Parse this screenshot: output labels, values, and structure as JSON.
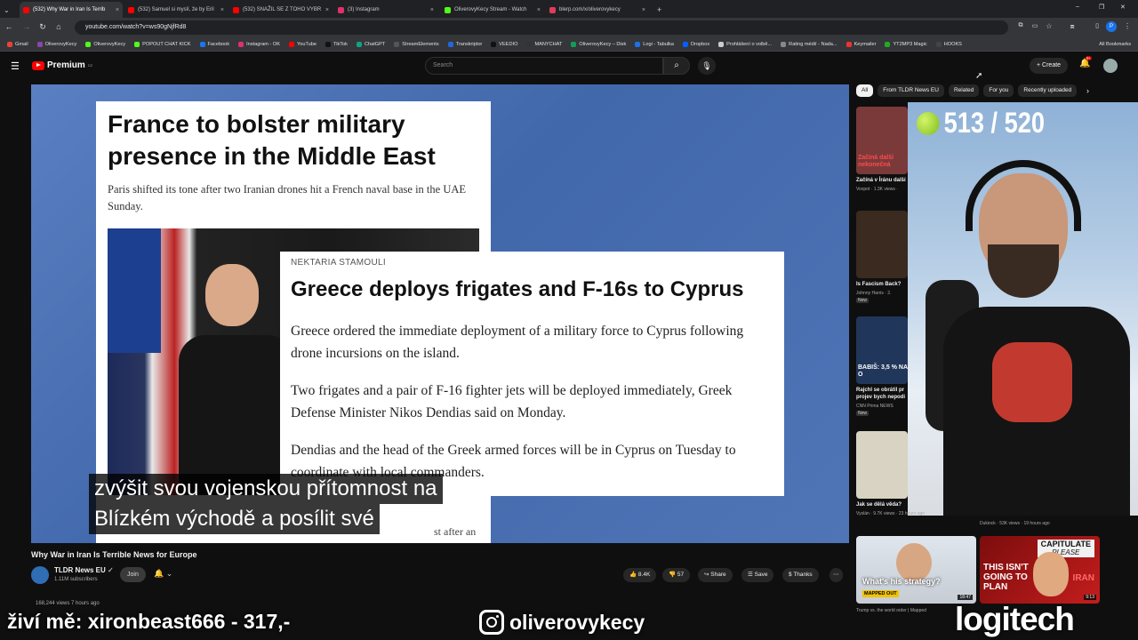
{
  "browser": {
    "tabs": [
      {
        "label": "(532) Why War in Iran Is Terrib",
        "color": "#ff0000"
      },
      {
        "label": "(532) Samuel si myslí, že by Eril",
        "color": "#ff0000"
      },
      {
        "label": "(532) SNAŽIL SE Z TOHO VYBR",
        "color": "#ff0000"
      },
      {
        "label": "(3) Instagram",
        "color": "#e1306c"
      },
      {
        "label": "OliverovyKecy Stream - Watch",
        "color": "#53fc18"
      },
      {
        "label": "blerp.com/x/oliverovykecy",
        "color": "#e23b5c"
      }
    ],
    "new_tab": "+",
    "url": "youtube.com/watch?v=ws90gNjfRd8",
    "bookmarks": [
      "Gmail",
      "OliverovyKecy",
      "OliverovyKecy",
      "POPOUT CHAT KICK",
      "Facebook",
      "Instagram - OK",
      "YouTube",
      "TikTok",
      "ChatGPT",
      "StreamElements",
      "Transkriptor",
      "VEEDIO",
      "MANYCHAT",
      "OliverovyKecy – Disk",
      "Logi - Tabulka",
      "Dropbox",
      "Prohlášení o volbě...",
      "Rating médií - Nada...",
      "Keymailer",
      "YT2MP3 Magic",
      "HOOKS"
    ],
    "all_bookmarks": "All Bookmarks"
  },
  "youtube": {
    "logo_text": "Premium",
    "logo_sup": "CZ",
    "search_placeholder": "Search",
    "create_label": "Create",
    "notif_count": "9+",
    "chips": [
      "All",
      "From TLDR News EU",
      "Related",
      "For you",
      "Recently uploaded"
    ]
  },
  "video_frame": {
    "card1_headline": "France to bolster military presence in the Middle East",
    "card1_sub": "Paris shifted its tone after two Iranian drones hit a French naval base in the UAE Sunday.",
    "card1_bottom": "st after an",
    "card2_byline": "NEKTARIA STAMOULI",
    "card2_headline": "Greece deploys frigates and F-16s to Cyprus",
    "card2_p1": "Greece ordered the immediate deployment of a military force to Cyprus following drone incursions on the island.",
    "card2_p2": "Two frigates and a pair of F-16 fighter jets will be deployed immediately, Greek Defense Minister Nikos Dendias said on Monday.",
    "card2_p3": "Dendias and the head of the Greek armed forces will be in Cyprus on Tuesday to coordinate with local commanders.",
    "subtitle_line1": "zvýšit svou vojenskou přítomnost na",
    "subtitle_line2": "Blízkém východě a posílit své"
  },
  "video_info": {
    "title": "Why War in Iran Is Terrible News for Europe",
    "channel": "TLDR News EU",
    "subscribers": "1.11M subscribers",
    "join": "Join",
    "likes": "8.4K",
    "dislikes": "57",
    "share": "Share",
    "save": "Save",
    "thanks": "Thanks",
    "views": "168,244 views  7 hours ago"
  },
  "sidebar": {
    "videos": [
      {
        "title": "Začíná v Íránu další",
        "meta": "Voxpot · 1.3K views ·",
        "thumb_text": "Začíná další nekonečná",
        "bg": "#7a3a3a"
      },
      {
        "title": "Is Fascism Back?",
        "meta": "Johnny Harris · 2.",
        "new": "New",
        "bg": "#3a2a20"
      },
      {
        "title": "Rajchl se obrátil pr",
        "title2": "projev bych nepodi",
        "meta": "CNN Prima NEWS",
        "new": "New",
        "thumb_text": "BABIŠ: 3,5 % NA O",
        "bg": "#20365a"
      },
      {
        "title": "Jak se dělá věda?",
        "meta": "Vyslán · 9.7K views · 23 hours ago",
        "bg": "#d8d3c2"
      }
    ],
    "extra_meta": "Dukiock · 53K views · 19 hours ago",
    "bottom": [
      {
        "thumb_text": "What's his strategy?",
        "badge": "MAPPED OUT",
        "duration": "18:47",
        "caption": "Trump vs. the world order | Mapped"
      },
      {
        "thumb_text1": "CAPITULATE",
        "thumb_text2": "PLEASE",
        "thumb_text3": "THIS ISN'T GOING TO PLAN",
        "thumb_text4": "IRAN",
        "duration": "9:13"
      }
    ]
  },
  "stream": {
    "counter": "513 / 520",
    "donation": "živí mě: xironbeast666 - 317,-",
    "instagram": "oliverovykecy",
    "sponsor": "logitech"
  }
}
